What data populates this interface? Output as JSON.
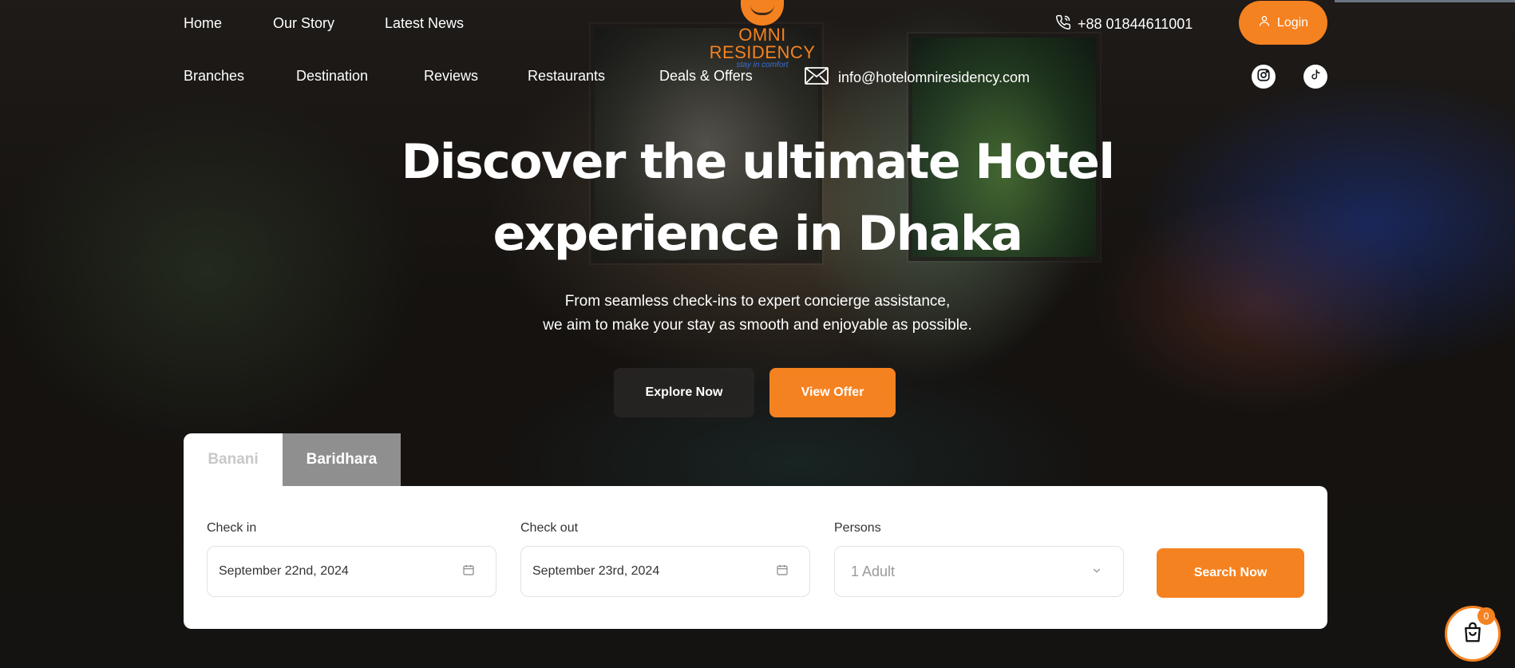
{
  "nav": {
    "primary": [
      {
        "label": "Home"
      },
      {
        "label": "Our Story"
      },
      {
        "label": "Latest News"
      }
    ],
    "secondary": [
      {
        "label": "Branches"
      },
      {
        "label": "Destination"
      },
      {
        "label": "Reviews"
      },
      {
        "label": "Restaurants"
      },
      {
        "label": "Deals & Offers"
      }
    ],
    "logo": {
      "name": "OMNI RESIDENCY",
      "tagline": "stay in comfort"
    },
    "phone": "+88 01844611001",
    "email": "info@hotelomniresidency.com",
    "login_label": "Login",
    "social": [
      {
        "icon": "instagram-icon"
      },
      {
        "icon": "tiktok-icon"
      }
    ]
  },
  "hero": {
    "title_line1": "Discover the ultimate Hotel",
    "title_line2": "experience in Dhaka",
    "subtitle_line1": "From seamless check-ins to expert concierge assistance,",
    "subtitle_line2": "we aim to make your stay as smooth and enjoyable as possible.",
    "explore_label": "Explore Now",
    "offer_label": "View Offer"
  },
  "booking": {
    "tabs": [
      {
        "label": "Banani",
        "active": false
      },
      {
        "label": "Baridhara",
        "active": true
      }
    ],
    "check_in": {
      "label": "Check in",
      "value": "September 22nd, 2024"
    },
    "check_out": {
      "label": "Check out",
      "value": "September 23rd, 2024"
    },
    "persons": {
      "label": "Persons",
      "value": "1 Adult"
    },
    "search_label": "Search Now"
  },
  "cart": {
    "count": "0"
  },
  "colors": {
    "accent": "#f58220",
    "logo_tagline": "#3b6fd6",
    "panel": "#ffffff"
  }
}
